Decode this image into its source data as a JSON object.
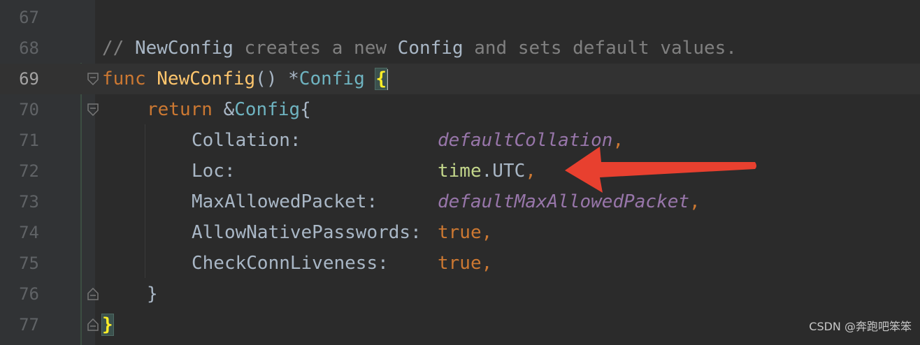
{
  "editor": {
    "lines": [
      {
        "num": "67"
      },
      {
        "num": "68",
        "comment_slashes": "// ",
        "comment_name": "NewConfig",
        "comment_mid": " creates a new ",
        "comment_type": "Config",
        "comment_end": " and sets default values."
      },
      {
        "num": "69",
        "kw": "func",
        "fn_name": "NewConfig",
        "parens": "() *",
        "type": "Config",
        "brace": "{"
      },
      {
        "num": "70",
        "kw": "return",
        "amp": " &",
        "type": "Config",
        "brace": "{"
      },
      {
        "num": "71",
        "field": "Collation:",
        "value": "defaultCollation",
        "comma": ","
      },
      {
        "num": "72",
        "field": "Loc:",
        "pkg": "time",
        "dot_val": ".UTC",
        "comma": ","
      },
      {
        "num": "73",
        "field": "MaxAllowedPacket:",
        "value": "defaultMaxAllowedPacket",
        "comma": ","
      },
      {
        "num": "74",
        "field": "AllowNativePasswords:",
        "value": "true",
        "comma": ","
      },
      {
        "num": "75",
        "field": "CheckConnLiveness:",
        "value": "true",
        "comma": ","
      },
      {
        "num": "76",
        "brace": "}"
      },
      {
        "num": "77",
        "brace": "}"
      }
    ]
  },
  "watermark": "CSDN @奔跑吧笨笨",
  "colors": {
    "background": "#2b2b2b",
    "keyword": "#cc7832",
    "function": "#ffc66d",
    "type": "#6fb4c1",
    "constant": "#9876aa",
    "arrow": "#e8402f"
  },
  "icons": [
    "fold-open-icon",
    "fold-close-icon",
    "arrow-annotation-icon"
  ]
}
